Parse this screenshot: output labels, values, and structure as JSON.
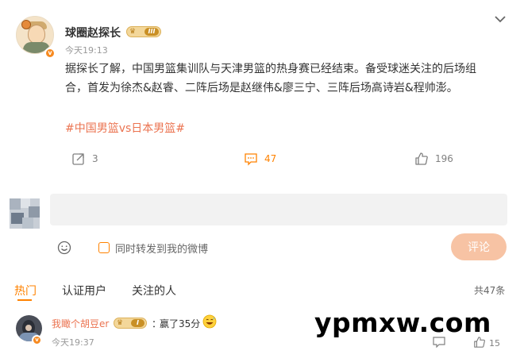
{
  "post": {
    "username": "球圈赵探长",
    "level_label": "III",
    "time": "今天19:13",
    "text": "据探长了解，中国男篮集训队与天津男篮的热身赛已经结束。备受球迷关注的后场组合，首发为徐杰&赵睿、二阵后场是赵继伟&廖三宁、三阵后场高诗岩&程帅澎。",
    "hashtag": "#中国男篮vs日本男篮#",
    "actions": {
      "share_count": "3",
      "comment_count": "47",
      "like_count": "196"
    }
  },
  "composer": {
    "repost_checkbox_label": "同时转发到我的微博",
    "submit_label": "评论",
    "input_placeholder": ""
  },
  "comment_tabs": {
    "tabs": [
      "热门",
      "认证用户",
      "关注的人"
    ],
    "total": "共47条"
  },
  "comments": [
    {
      "username": "我瞰个胡豆er",
      "level_label": "I",
      "colon": "：",
      "text": "赢了35分",
      "emoji": "grinning-sweat-emoji",
      "time": "今天19:37",
      "like_count": "15"
    }
  ],
  "watermark": "ypmxw.com",
  "colors": {
    "accent": "#ff8200",
    "link": "#eb7350",
    "submit_disabled": "#f7c3a4",
    "input_bg": "#f2f2f2"
  },
  "icons": {
    "more": "chevron-down-icon",
    "share": "share-icon",
    "comment": "comment-icon",
    "like": "thumbs-up-icon",
    "emoji": "smiley-icon",
    "reply": "reply-icon"
  }
}
